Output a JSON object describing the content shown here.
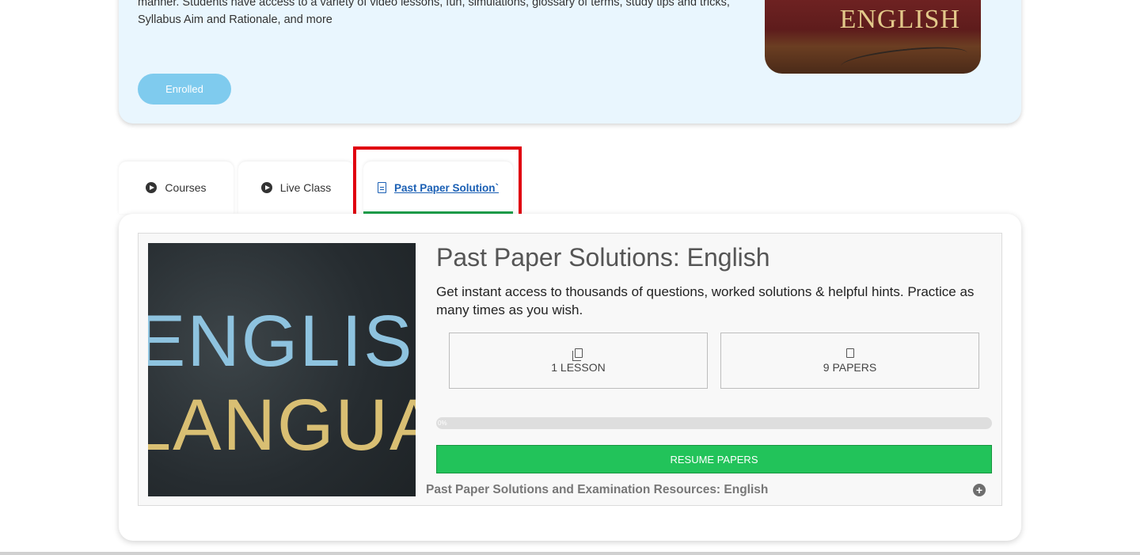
{
  "hero": {
    "description": "manner. Students have access to a variety of video lessons, fun, simulations, glossary of terms, study tips and tricks, Syllabus Aim and Rationale, and more",
    "enrolled_label": "Enrolled",
    "image_word": "ENGLISH"
  },
  "tabs": [
    {
      "label": "Courses",
      "icon": "play-circle-icon"
    },
    {
      "label": "Live Class",
      "icon": "play-circle-icon"
    },
    {
      "label": "Past Paper Solution`",
      "icon": "document-icon",
      "active": true
    }
  ],
  "card": {
    "title": "Past Paper Solutions: English",
    "description": "Get instant access to thousands of questions, worked solutions & helpful hints. Practice as many times as you wish.",
    "image_text_line1": "ENGLISH",
    "image_text_line2": "LANGUAGE",
    "stats": {
      "lessons": "1 LESSON",
      "papers": "9 PAPERS"
    },
    "progress_label": "0%",
    "progress_value": 0,
    "resume_label": "RESUME PAPERS",
    "section_title": "Past Paper Solutions and Examination Resources: English",
    "expand_symbol": "+"
  },
  "colors": {
    "hero_background": "#e9f6fe",
    "enrolled_button": "#7fcbee",
    "active_tab_text": "#1a5fb4",
    "active_tab_underline": "#1aa04a",
    "highlight_box": "#e0000f",
    "resume_button": "#22c35a"
  }
}
